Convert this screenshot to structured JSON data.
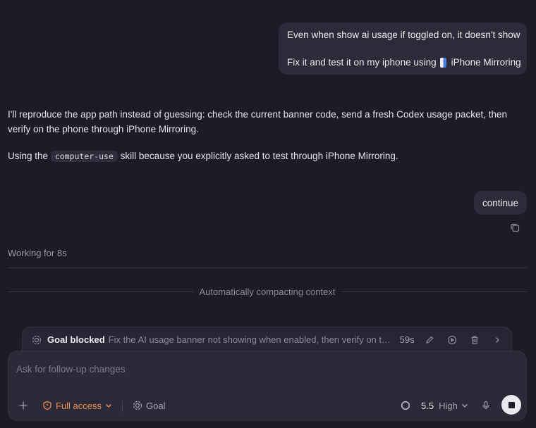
{
  "messages": {
    "user_1": {
      "line1": "Even when show ai usage if toggled on, it doesn't show",
      "line2_text": "Fix it and test it on my iphone using",
      "line2_app": "iPhone Mirroring"
    },
    "assistant_1": "I'll reproduce the app path instead of guessing: check the current banner code, send a fresh Codex usage packet, then verify on the phone through iPhone Mirroring.",
    "assistant_2": {
      "prefix": "Using the",
      "code": "computer-use",
      "suffix": "skill because you explicitly asked to test through iPhone Mirroring."
    },
    "user_2": "continue"
  },
  "status": {
    "working": "Working for 8s",
    "compacting": "Automatically compacting context"
  },
  "goal": {
    "title": "Goal blocked",
    "description": "Fix the AI usage banner not showing when enabled, then verify on the phone through iPhone Mirroring",
    "elapsed": "59s"
  },
  "composer": {
    "placeholder": "Ask for follow-up changes",
    "access_label": "Full access",
    "goal_label": "Goal",
    "model": "5.5",
    "effort": "High"
  },
  "colors": {
    "background": "#1c1c28",
    "accent_access": "#f08a4b",
    "bubble": "#2b2b39"
  },
  "icons": [
    "copy-icon",
    "goal-icon",
    "edit-icon",
    "play-icon",
    "trash-icon",
    "chevron-right-icon",
    "plus-icon",
    "warning-icon",
    "chevron-down-icon",
    "mic-icon",
    "stop-icon"
  ]
}
